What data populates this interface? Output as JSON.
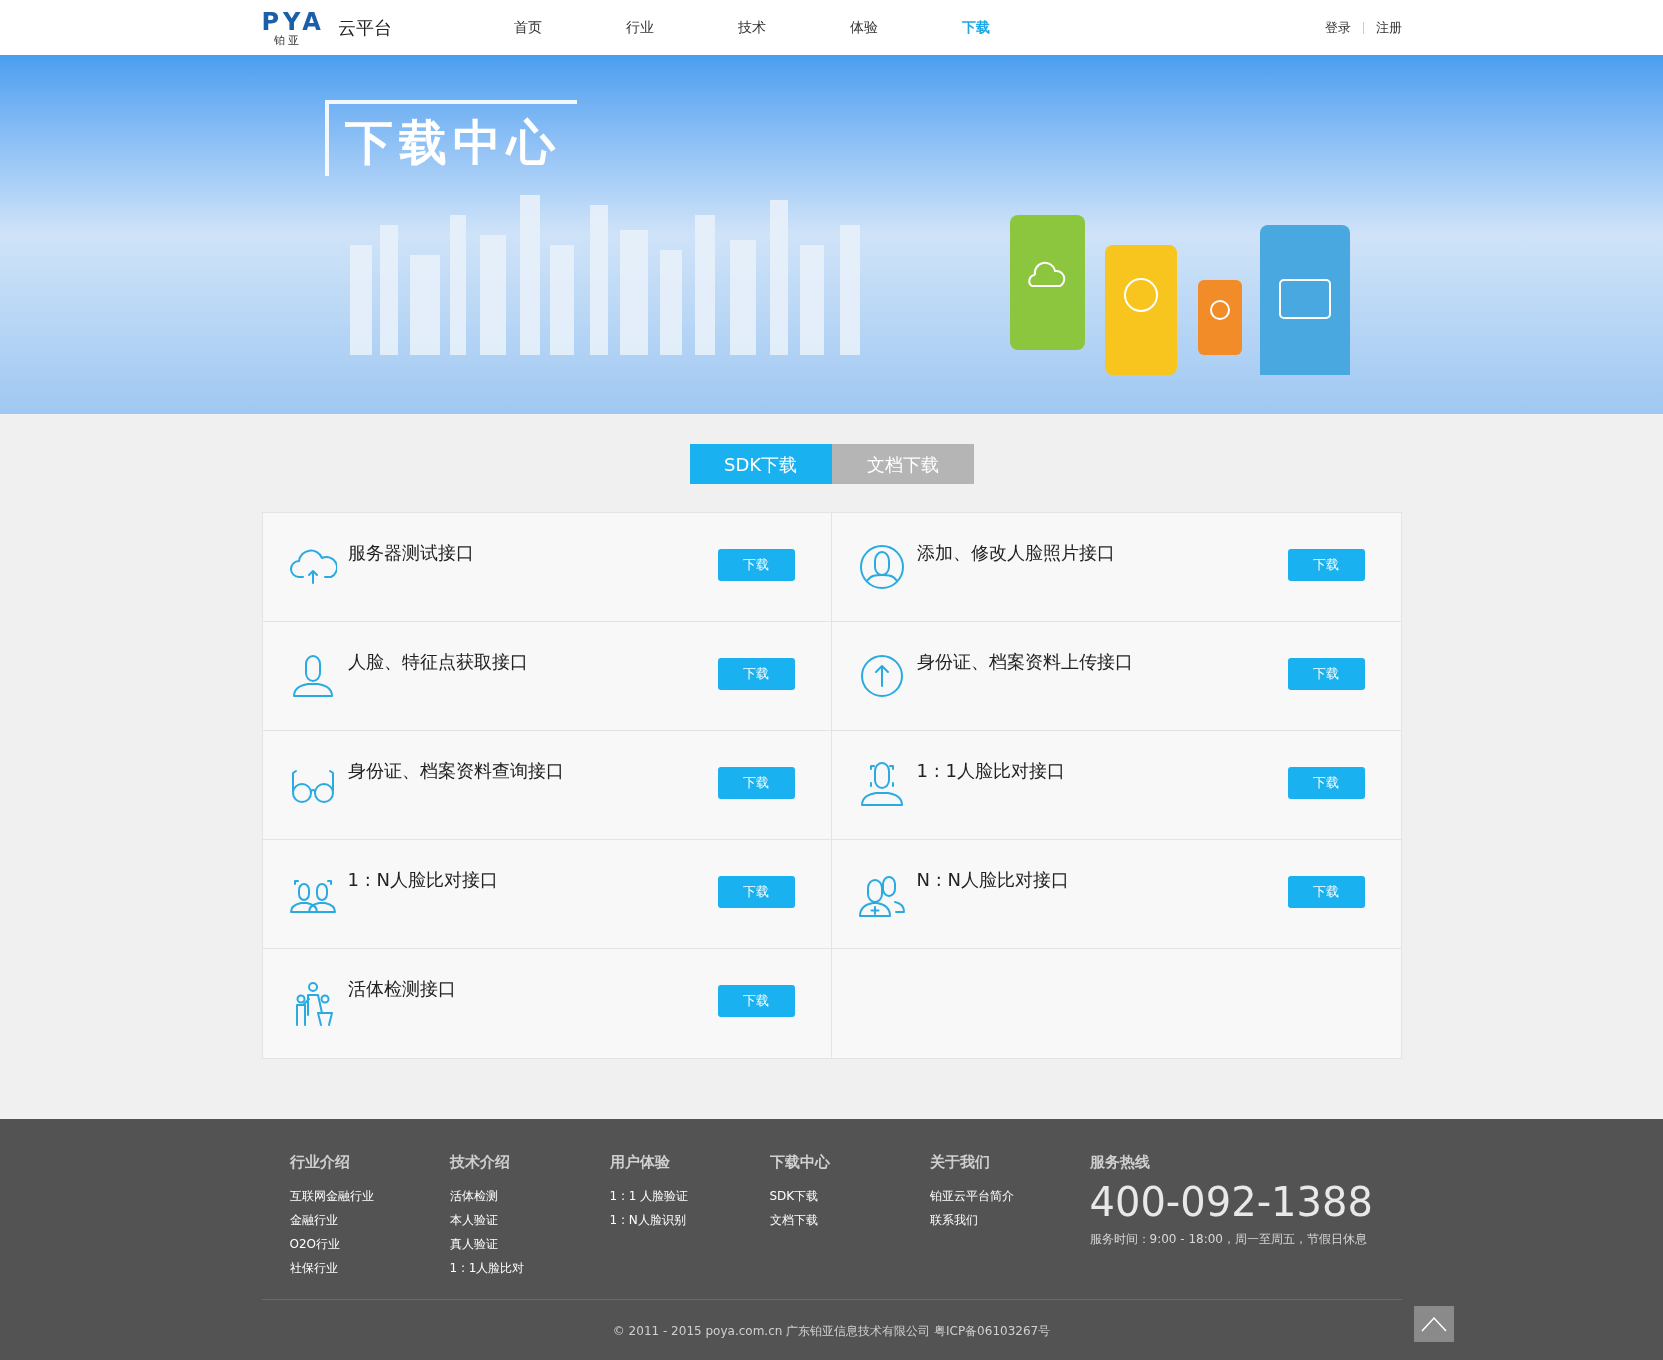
{
  "header": {
    "logo_letters": "PYA",
    "logo_sub": "铂 亚",
    "brand": "云平台",
    "nav": [
      {
        "label": "首页",
        "selected": false
      },
      {
        "label": "行业",
        "selected": false
      },
      {
        "label": "技术",
        "selected": false
      },
      {
        "label": "体验",
        "selected": false
      },
      {
        "label": "下载",
        "selected": true
      }
    ],
    "auth": [
      "登录",
      "注册"
    ]
  },
  "banner": {
    "title": "下载中心"
  },
  "tabs": [
    {
      "label": "SDK下载",
      "selected": true
    },
    {
      "label": "文档下载",
      "selected": false
    }
  ],
  "downloads": [
    {
      "name": "服务器测试接口",
      "button": "下载"
    },
    {
      "name": "添加、修改人脸照片接口",
      "button": "下载"
    },
    {
      "name": "人脸、特征点获取接口",
      "button": "下载"
    },
    {
      "name": "身份证、档案资料上传接口",
      "button": "下载"
    },
    {
      "name": "身份证、档案资料查询接口",
      "button": "下载"
    },
    {
      "name": "1 : 1人脸比对接口",
      "button": "下载"
    },
    {
      "name": "1 : N人脸比对接口",
      "button": "下载"
    },
    {
      "name": "N : N人脸比对接口",
      "button": "下载"
    },
    {
      "name": "活体检测接口",
      "button": "下载"
    }
  ],
  "footer": {
    "columns": [
      {
        "title": "行业介绍",
        "links": [
          "互联网金融行业",
          "金融行业",
          "O2O行业",
          "社保行业"
        ]
      },
      {
        "title": "技术介绍",
        "links": [
          "活体检测",
          "本人验证",
          "真人验证",
          "1 : 1人脸比对"
        ]
      },
      {
        "title": "用户体验",
        "links": [
          "1 : 1 人脸验证",
          "1 : N人脸识别"
        ]
      },
      {
        "title": "下载中心",
        "links": [
          "SDK下载",
          "文档下载"
        ]
      },
      {
        "title": "关于我们",
        "links": [
          "铂亚云平台简介",
          "联系我们"
        ]
      }
    ],
    "hotline": {
      "title": "服务热线",
      "phone": "400-092-1388",
      "hours": "服务时间：9:00 - 18:00，周一至周五，节假日休息"
    },
    "copyright": "© 2011 - 2015 poya.com.cn 广东铂亚信息技术有限公司 粤ICP备06103267号"
  }
}
